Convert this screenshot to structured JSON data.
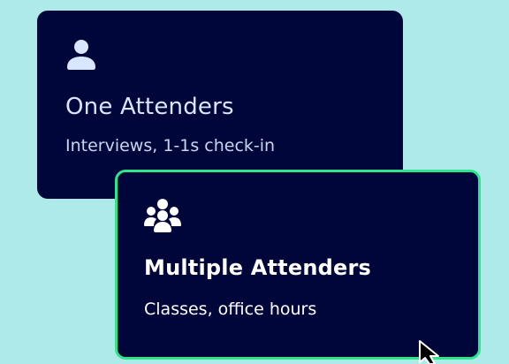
{
  "colors": {
    "background": "#aeeaea",
    "card": "#00063a",
    "selected_border": "#2ee68a",
    "text_primary": "#d9e6ff"
  },
  "options": [
    {
      "icon": "person-icon",
      "title": "One Attenders",
      "description": "Interviews, 1-1s check-in",
      "selected": false
    },
    {
      "icon": "group-icon",
      "title": "Multiple Attenders",
      "description": "Classes, office hours",
      "selected": true
    }
  ],
  "cursor": "pointer-cursor-icon"
}
